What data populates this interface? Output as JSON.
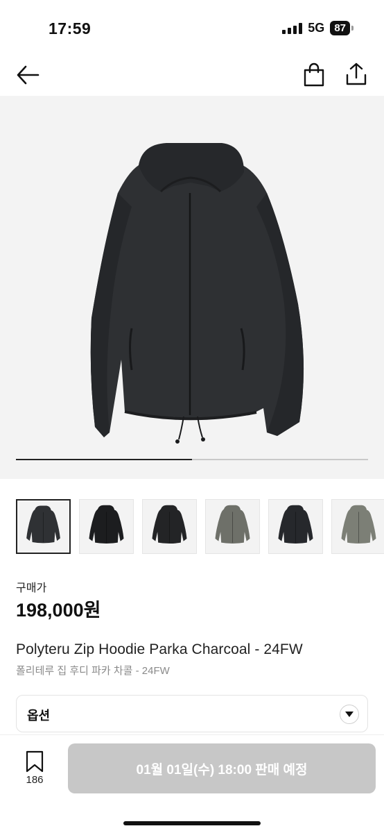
{
  "status_bar": {
    "time": "17:59",
    "network": "5G",
    "battery": "87"
  },
  "nav": {
    "back_icon": "arrow-left-icon",
    "bag_icon": "shopping-bag-icon",
    "share_icon": "share-icon"
  },
  "gallery": {
    "image_icon": "hoodie-parka-image",
    "progress": 0.5,
    "thumbnails": [
      {
        "color": "#2f3134",
        "style": "parka-charcoal"
      },
      {
        "color": "#1c1d1f",
        "style": "hoodie-black"
      },
      {
        "color": "#232426",
        "style": "parka-black"
      },
      {
        "color": "#6e7069",
        "style": "parka-olive"
      },
      {
        "color": "#26282c",
        "style": "parka-navy"
      },
      {
        "color": "#7c7f76",
        "style": "parka-sage"
      }
    ]
  },
  "product": {
    "price_label": "구매가",
    "price": "198,000원",
    "title_en": "Polyteru Zip Hoodie Parka Charcoal - 24FW",
    "title_ko": "폴리테루 집 후디 파카 차콜 - 24FW"
  },
  "options": {
    "label": "옵션",
    "chevron_icon": "chevron-down-icon"
  },
  "bottom": {
    "bookmark_icon": "bookmark-icon",
    "bookmark_count": "186",
    "sale_button_label": "01월 01일(수) 18:00 판매 예정"
  },
  "colors": {
    "button_disabled": "#c7c7c7",
    "hero_bg": "#f3f3f3",
    "accent": "#111111"
  }
}
